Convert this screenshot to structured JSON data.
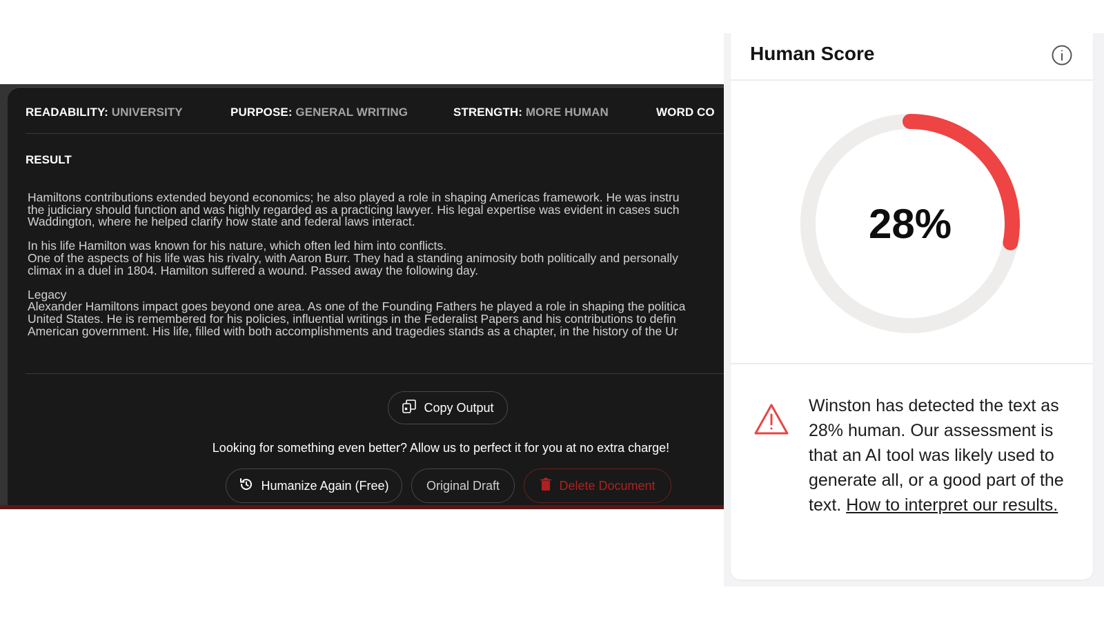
{
  "left_panel": {
    "settings": [
      {
        "key": "READABILITY:",
        "value": "UNIVERSITY"
      },
      {
        "key": "PURPOSE:",
        "value": "GENERAL WRITING"
      },
      {
        "key": "STRENGTH:",
        "value": "MORE HUMAN"
      },
      {
        "key": "WORD CO",
        "value": ""
      }
    ],
    "result_label": "RESULT",
    "result_lines": [
      "Hamiltons contributions extended beyond economics; he also played a role in shaping Americas framework. He was instru",
      "the judiciary should function and was highly regarded as a practicing lawyer. His legal expertise was evident in cases such",
      "Waddington, where he helped clarify how state and federal laws interact.",
      "In his life Hamilton was known for his nature, which often led him into conflicts.",
      "One of the aspects of his life was his rivalry, with Aaron Burr. They had a standing animosity both politically and personally",
      "climax in a duel in 1804. Hamilton suffered a wound. Passed away the following day.",
      "Legacy",
      "Alexander Hamiltons impact goes beyond one area. As one of the Founding Fathers he played a role in shaping the politica",
      "United States. He is remembered for his policies, influential writings in the Federalist Papers and his contributions to defin",
      "American government. His life, filled with both accomplishments and tragedies stands as a chapter, in the history of the Ur"
    ],
    "copy_output_label": "Copy Output",
    "promo_text": "Looking for something even better? Allow us to perfect it for you at no extra charge!",
    "humanize_again_label": "Humanize Again (Free)",
    "original_draft_label": "Original Draft",
    "delete_document_label": "Delete Document"
  },
  "score_card": {
    "title": "Human Score",
    "score_percent": 28,
    "score_label": "28%",
    "assessment_text": "Winston has detected the text as 28% human. Our assessment is that an AI tool was likely used to generate all, or a good part of the text. ",
    "interpret_link": "How to interpret our results.",
    "colors": {
      "arc": "#ee4444",
      "track": "#efedeb",
      "warning": "#e64545"
    },
    "icons": [
      "info-icon",
      "warning-icon"
    ]
  }
}
